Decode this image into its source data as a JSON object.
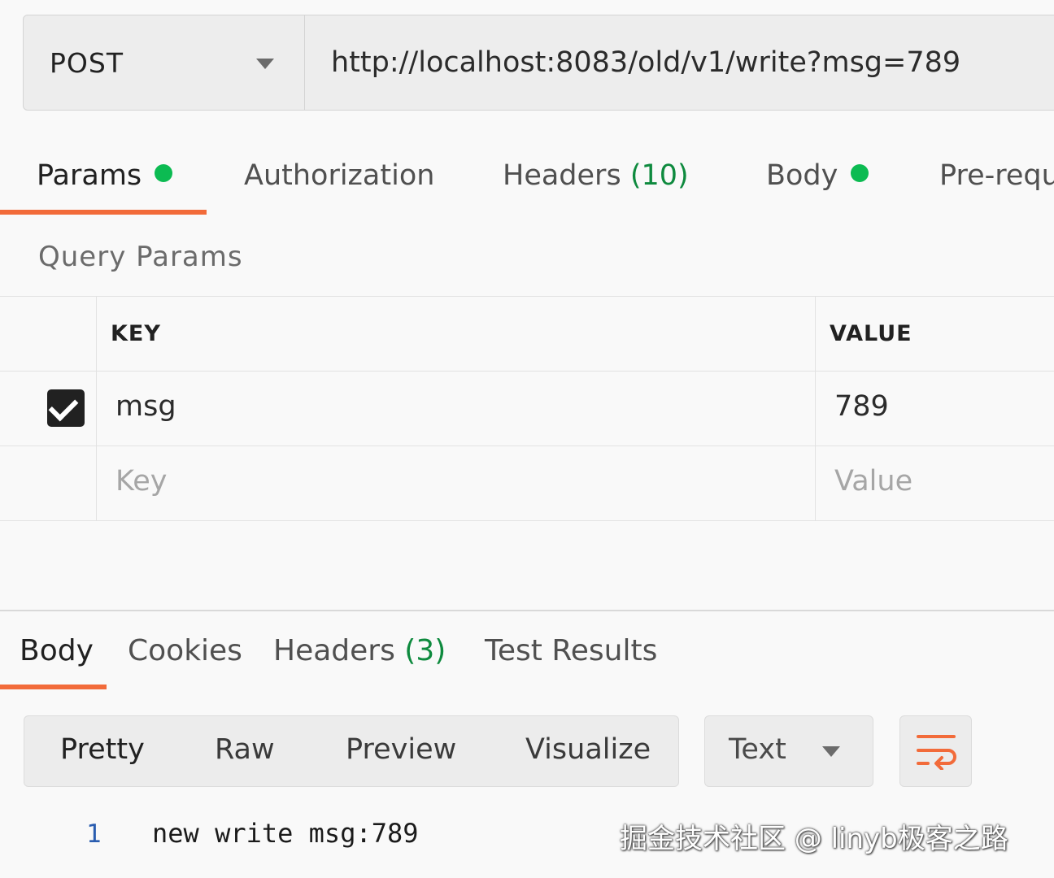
{
  "request": {
    "method": "POST",
    "url": "http://localhost:8083/old/v1/write?msg=789"
  },
  "request_tabs": [
    {
      "label": "Params",
      "active": true,
      "dot": true
    },
    {
      "label": "Authorization",
      "active": false
    },
    {
      "label": "Headers",
      "count": "(10)",
      "active": false
    },
    {
      "label": "Body",
      "active": false,
      "dot": true
    },
    {
      "label": "Pre-requ",
      "active": false
    }
  ],
  "query_params": {
    "title": "Query Params",
    "headers": {
      "key": "KEY",
      "value": "VALUE"
    },
    "rows": [
      {
        "checked": true,
        "key": "msg",
        "value": "789"
      }
    ],
    "placeholder": {
      "key": "Key",
      "value": "Value"
    }
  },
  "response_tabs": [
    {
      "label": "Body",
      "active": true
    },
    {
      "label": "Cookies",
      "active": false
    },
    {
      "label": "Headers",
      "count": "(3)",
      "active": false
    },
    {
      "label": "Test Results",
      "active": false
    }
  ],
  "format": {
    "modes": [
      "Pretty",
      "Raw",
      "Preview",
      "Visualize"
    ],
    "selected_mode": "Pretty",
    "type": "Text"
  },
  "response_body": {
    "line_number": "1",
    "text": "new write msg:789"
  },
  "watermark": "掘金技术社区 @ linyb极客之路",
  "colors": {
    "accent": "#f26b3a",
    "status_dot": "#0cbb52",
    "count": "#0e8a3e",
    "line_number": "#2a5db0"
  }
}
